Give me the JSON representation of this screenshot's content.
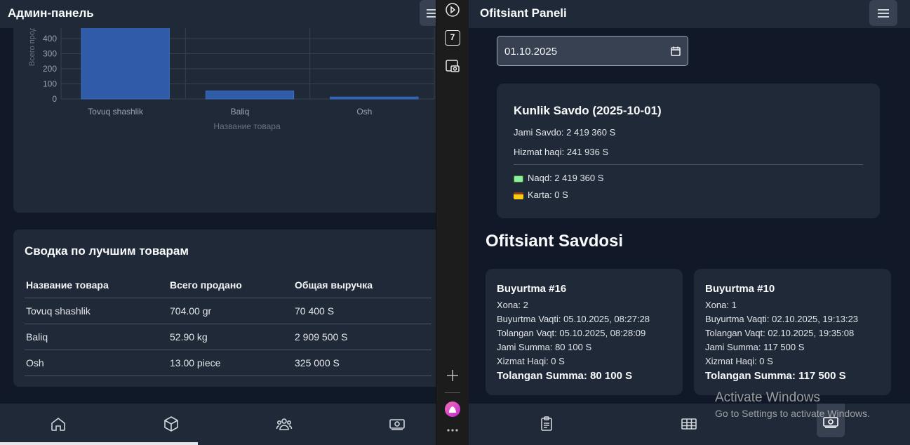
{
  "admin": {
    "title": "Админ-панель",
    "chart_data": {
      "type": "bar",
      "categories": [
        "Tovuq shashlik",
        "Baliq",
        "Osh"
      ],
      "values": [
        704,
        52.9,
        13
      ],
      "xlabel": "Название товара",
      "ylabel": "Всего прод",
      "yticks": [
        "0",
        "100",
        "200",
        "300",
        "400"
      ],
      "color": "#2f5ba8"
    },
    "summary": {
      "title": "Сводка по лучшим товарам",
      "headers": [
        "Название товара",
        "Всего продано",
        "Общая выручка"
      ],
      "rows": [
        [
          "Tovuq shashlik",
          "704.00 gr",
          "70 400 S"
        ],
        [
          "Baliq",
          "52.90 kg",
          "2 909 500 S"
        ],
        [
          "Osh",
          "13.00 piece",
          "325 000 S"
        ]
      ]
    },
    "nav": [
      "home-icon",
      "box-icon",
      "users-icon",
      "money-icon"
    ]
  },
  "sidebar": {
    "icons": [
      "play-icon",
      "calendar-icon",
      "camera-icon",
      "plus-icon",
      "app-icon",
      "more-icon"
    ],
    "calendar_label": "7"
  },
  "waiter": {
    "title": "Ofitsiant Paneli",
    "date_value": "01.10.2025",
    "daily": {
      "title": "Kunlik Savdo (2025-10-01)",
      "jami": "Jami Savdo: 2 419 360 S",
      "hizmat": "Hizmat haqi: 241 936 S",
      "naqd": "Naqd: 2 419 360 S",
      "karta": "Karta: 0 S"
    },
    "section_title": "Ofitsiant Savdosi",
    "orders": [
      {
        "title": "Buyurtma #16",
        "xona": "Xona: 2",
        "buyurtma_vaqti": "Buyurtma Vaqti: 05.10.2025, 08:27:28",
        "tolangan_vaqt": "Tolangan Vaqt: 05.10.2025, 08:28:09",
        "jami": "Jami Summa: 80 100 S",
        "xizmat": "Xizmat Haqi: 0 S",
        "tolangan": "Tolangan Summa: 80 100 S"
      },
      {
        "title": "Buyurtma #10",
        "xona": "Xona: 1",
        "buyurtma_vaqti": "Buyurtma Vaqti: 02.10.2025, 19:13:23",
        "tolangan_vaqt": "Tolangan Vaqt: 02.10.2025, 19:35:08",
        "jami": "Jami Summa: 117 500 S",
        "xizmat": "Xizmat Haqi: 0 S",
        "tolangan": "Tolangan Summa: 117 500 S"
      }
    ],
    "nav": [
      "clipboard-icon",
      "table-icon",
      "money-icon"
    ]
  },
  "watermark": {
    "line1": "Activate Windows",
    "line2": "Go to Settings to activate Windows."
  }
}
